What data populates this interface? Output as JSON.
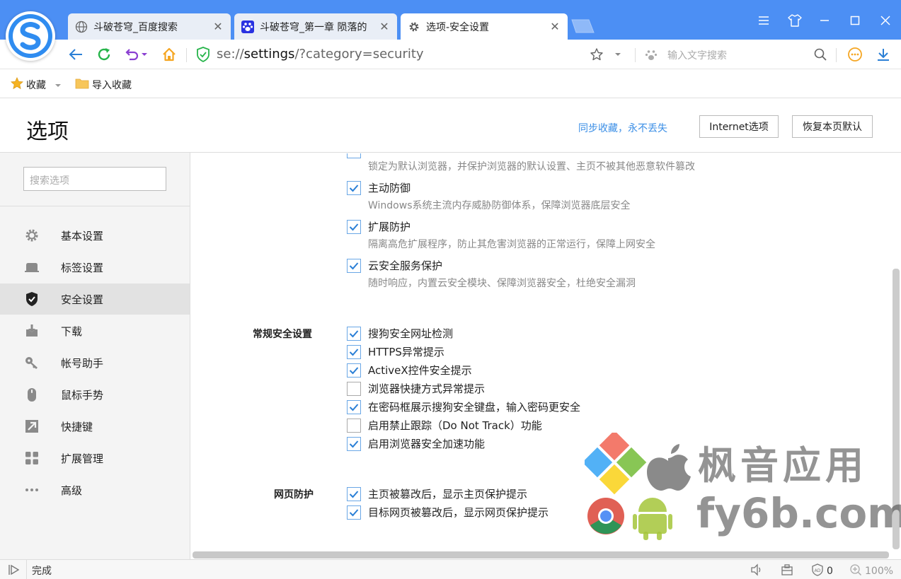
{
  "tabs": [
    {
      "title": "斗破苍穹_百度搜索",
      "icon": "globe-icon",
      "active": false
    },
    {
      "title": "斗破苍穹_第一章 陨落的",
      "icon": "baidu-paw-icon",
      "active": false
    },
    {
      "title": "选项-安全设置",
      "icon": "gear-icon",
      "active": true
    }
  ],
  "address_bar": {
    "url_scheme": "se://",
    "url_host": "settings",
    "url_path": "/?category=security",
    "search_placeholder": "输入文字搜索"
  },
  "bookmarks": {
    "favorites_label": "收藏",
    "import_label": "导入收藏"
  },
  "header": {
    "title": "选项",
    "sync_link": "同步收藏，永不丢失",
    "internet_options_button": "Internet选项",
    "restore_defaults_button": "恢复本页默认"
  },
  "sidebar": {
    "search_placeholder": "搜索选项",
    "items": [
      {
        "label": "基本设置",
        "icon": "gear-icon",
        "active": false
      },
      {
        "label": "标签设置",
        "icon": "tab-icon",
        "active": false
      },
      {
        "label": "安全设置",
        "icon": "shield-check-icon",
        "active": true
      },
      {
        "label": "下载",
        "icon": "download-icon",
        "active": false
      },
      {
        "label": "帐号助手",
        "icon": "key-icon",
        "active": false
      },
      {
        "label": "鼠标手势",
        "icon": "mouse-icon",
        "active": false
      },
      {
        "label": "快捷键",
        "icon": "shortcut-arrow-icon",
        "active": false
      },
      {
        "label": "扩展管理",
        "icon": "extensions-grid-icon",
        "active": false
      },
      {
        "label": "高级",
        "icon": "more-dots-icon",
        "active": false
      }
    ]
  },
  "protection": {
    "partial_desc": "锁定为默认浏览器，并保护浏览器的默认设置、主页不被其他恶意软件篡改",
    "options": [
      {
        "label": "主动防御",
        "desc": "Windows系统主流内存威胁防御体系，保障浏览器底层安全",
        "checked": true
      },
      {
        "label": "扩展防护",
        "desc": "隔离高危扩展程序，防止其危害浏览器的正常运行，保障上网安全",
        "checked": true
      },
      {
        "label": "云安全服务保护",
        "desc": "随时响应，内置云安全模块、保障浏览器安全，杜绝安全漏洞",
        "checked": true
      }
    ]
  },
  "general_security": {
    "section_label": "常规安全设置",
    "options": [
      {
        "label": "搜狗安全网址检测",
        "checked": true
      },
      {
        "label": "HTTPS异常提示",
        "checked": true
      },
      {
        "label": "ActiveX控件安全提示",
        "checked": true
      },
      {
        "label": "浏览器快捷方式异常提示",
        "checked": false
      },
      {
        "label": "在密码框展示搜狗安全键盘，输入密码更安全",
        "checked": true
      },
      {
        "label": "启用禁止跟踪（Do Not Track）功能",
        "checked": false
      },
      {
        "label": "启用浏览器安全加速功能",
        "checked": true
      }
    ]
  },
  "web_protection": {
    "section_label": "网页防护",
    "options": [
      {
        "label": "主页被篡改后，显示主页保护提示",
        "checked": true
      },
      {
        "label": "目标网页被篡改后，显示网页保护提示",
        "checked": true
      }
    ]
  },
  "watermark": {
    "text_cn": "枫音应用",
    "text_url": "fy6b.com"
  },
  "statusbar": {
    "status_text": "完成",
    "ad_block_count": "0",
    "zoom": "100%"
  },
  "colors": {
    "titlebar": "#4c8ff4",
    "accent": "#3a8ee6",
    "checkbox_check": "#2a7fd6",
    "home_icon": "#f5a623",
    "refresh_icon": "#26b44a",
    "undo_icon": "#8a3fd1"
  }
}
